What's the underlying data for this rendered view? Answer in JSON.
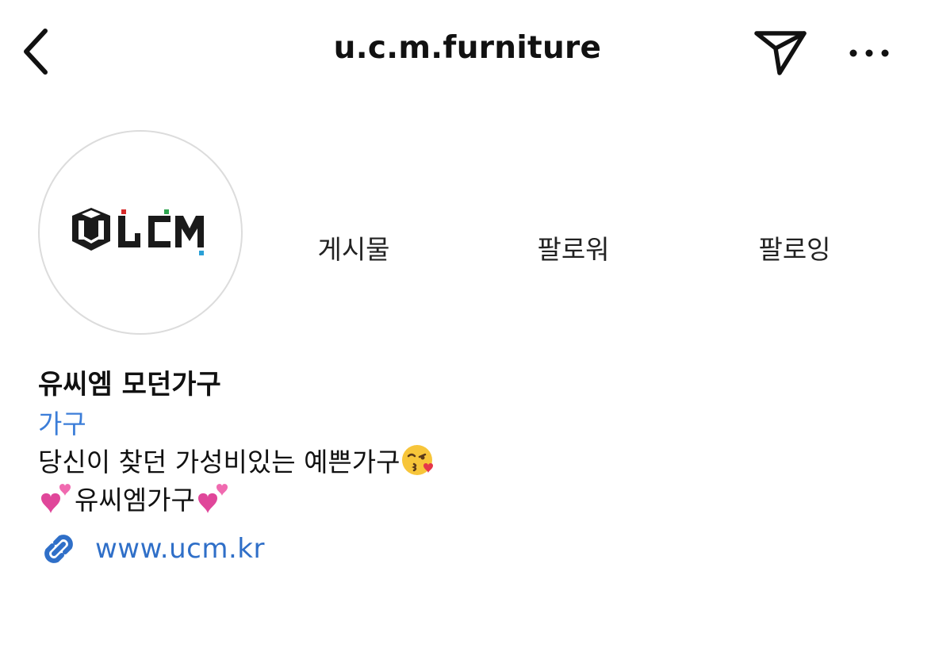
{
  "header": {
    "username": "u.c.m.furniture",
    "back_icon": "chevron-left-icon",
    "send_icon": "paper-plane-icon",
    "more_icon": "ellipsis-horizontal-icon"
  },
  "profile": {
    "avatar_logo_text": "UCM",
    "stats": [
      {
        "label": "게시물"
      },
      {
        "label": "팔로워"
      },
      {
        "label": "팔로잉"
      }
    ]
  },
  "bio": {
    "display_name": "유씨엠 모던가구",
    "category": "가구",
    "line1": "당신이 찾던 가성비있는 예쁜가구",
    "line1_emoji": "kissing-face-with-heart-emoji",
    "line2": "유씨엠가구",
    "line2_emoji": "two-hearts-emoji",
    "link_icon": "link-icon",
    "link": "www.ucm.kr"
  },
  "colors": {
    "text": "#111111",
    "link_blue": "#2f6fc8",
    "category_blue": "#3b7dd8",
    "avatar_border": "#dcdcdc"
  }
}
